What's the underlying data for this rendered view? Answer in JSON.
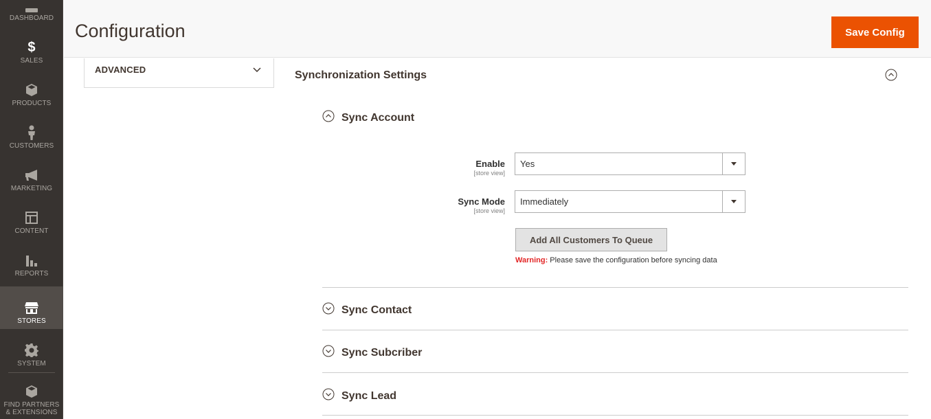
{
  "nav": {
    "items": [
      {
        "label": "Dashboard",
        "icon": "dashboard-icon"
      },
      {
        "label": "Sales",
        "icon": "dollar-icon"
      },
      {
        "label": "Products",
        "icon": "cube-icon"
      },
      {
        "label": "Customers",
        "icon": "person-icon"
      },
      {
        "label": "Marketing",
        "icon": "megaphone-icon"
      },
      {
        "label": "Content",
        "icon": "layout-icon"
      },
      {
        "label": "Reports",
        "icon": "bar-chart-icon"
      },
      {
        "label": "Stores",
        "icon": "storefront-icon"
      },
      {
        "label": "System",
        "icon": "gear-icon"
      },
      {
        "label_line1": "Find Partners",
        "label_line2": "& Extensions",
        "icon": "box-icon"
      }
    ],
    "active": "Stores"
  },
  "header": {
    "title": "Configuration",
    "save_label": "Save Config",
    "accent": "#eb5202"
  },
  "tabs": {
    "title": "ADVANCED"
  },
  "section": {
    "title": "Synchronization Settings",
    "groups": {
      "sync_account": {
        "title": "Sync Account",
        "fields": {
          "enable": {
            "label": "Enable",
            "scope": "[store view]",
            "value": "Yes"
          },
          "sync_mode": {
            "label": "Sync Mode",
            "scope": "[store view]",
            "value": "Immediately"
          }
        },
        "button_label": "Add All Customers To Queue",
        "warning_label": "Warning:",
        "warning_text": " Please save the configuration before syncing data",
        "warning_color": "#e22626"
      },
      "sync_contact": {
        "title": "Sync Contact"
      },
      "sync_subscriber": {
        "title": "Sync Subcriber"
      },
      "sync_lead": {
        "title": "Sync Lead"
      }
    }
  }
}
